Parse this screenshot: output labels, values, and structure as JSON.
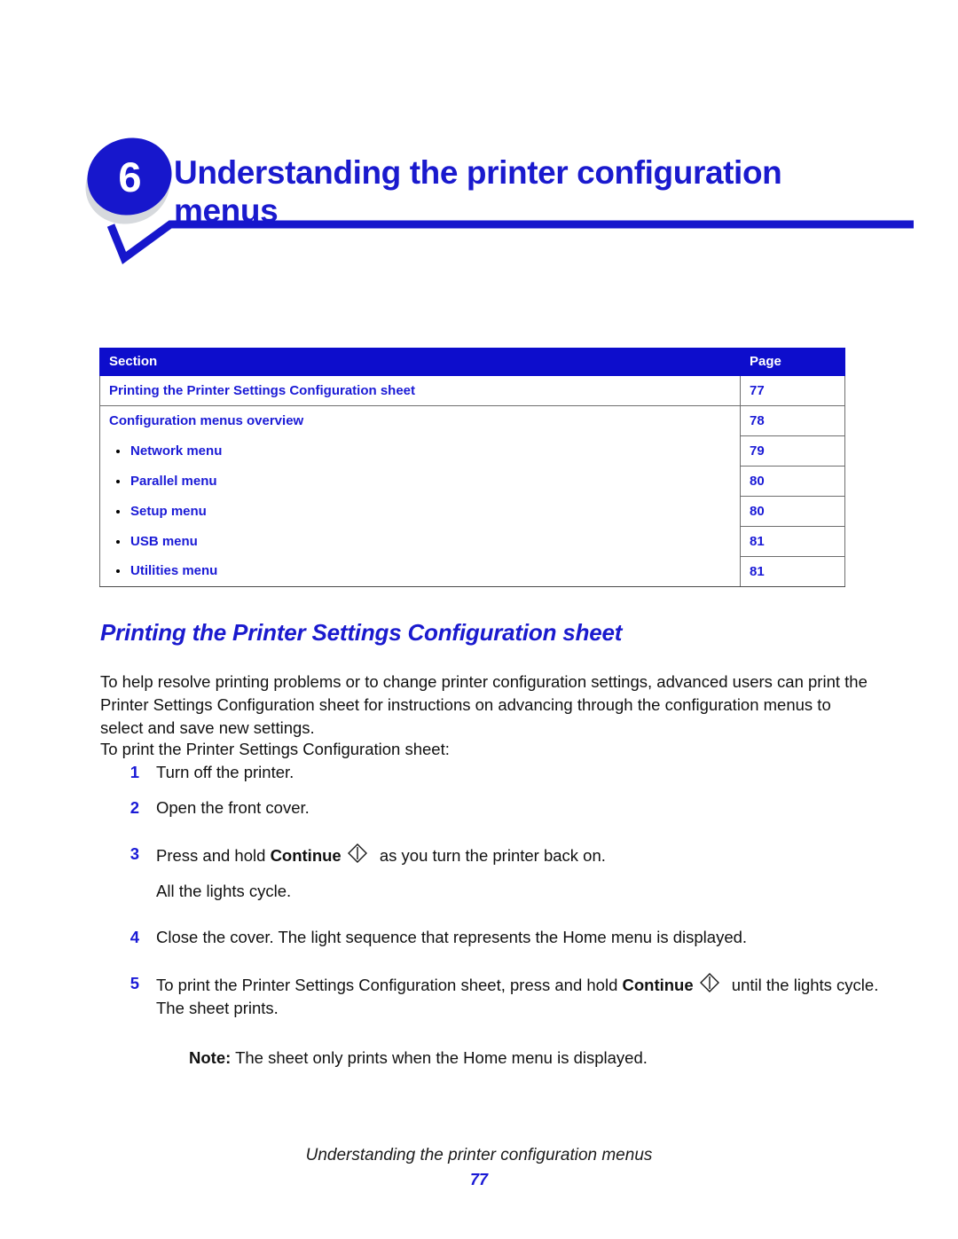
{
  "chapter": {
    "number": "6",
    "title": "Understanding the printer configuration menus"
  },
  "toc": {
    "headers": {
      "section": "Section",
      "page": "Page"
    },
    "rows": [
      {
        "label": "Printing the Printer Settings Configuration sheet",
        "page": "77",
        "sub": false
      },
      {
        "label": "Configuration menus overview",
        "page": "78",
        "sub": false
      },
      {
        "label": "Network menu",
        "page": "79",
        "sub": true
      },
      {
        "label": "Parallel menu",
        "page": "80",
        "sub": true
      },
      {
        "label": "Setup menu",
        "page": "80",
        "sub": true
      },
      {
        "label": "USB menu",
        "page": "81",
        "sub": true
      },
      {
        "label": "Utilities menu",
        "page": "81",
        "sub": true
      }
    ]
  },
  "section": {
    "heading": "Printing the Printer Settings Configuration sheet",
    "paragraph_1": "To help resolve printing problems or to change printer configuration settings, advanced users can print the Printer Settings Configuration sheet for instructions on advancing through the configuration menus to select and save new settings.",
    "paragraph_2": "To print the Printer Settings Configuration sheet:"
  },
  "steps": {
    "step1": {
      "num": "1",
      "text": "Turn off the printer."
    },
    "step2": {
      "num": "2",
      "text": "Open the front cover."
    },
    "step3": {
      "num": "3",
      "text_before": "Press and hold ",
      "bold": "Continue",
      "text_after": " as you turn the printer back on.",
      "sub_text": "All the lights cycle."
    },
    "step4": {
      "num": "4",
      "text": "Close the cover. The light sequence that represents the Home menu is displayed."
    },
    "step5": {
      "num": "5",
      "text_before": "To print the Printer Settings Configuration sheet, press and hold ",
      "bold": "Continue",
      "text_after": " until the lights cycle. The sheet prints."
    },
    "note": {
      "label": "Note:",
      "text": " The sheet only prints when the Home menu is displayed."
    }
  },
  "icons": {
    "continue_button": "continue-diamond-icon"
  },
  "footer": {
    "title": "Understanding the printer configuration menus",
    "page_number": "77"
  },
  "colors": {
    "brand_blue": "#1a1ace",
    "header_fill": "#0d0dcc",
    "link_blue": "#1a1ad6",
    "badge_shadow": "#d6d9dd",
    "rule_gray": "#6e6e6e"
  }
}
